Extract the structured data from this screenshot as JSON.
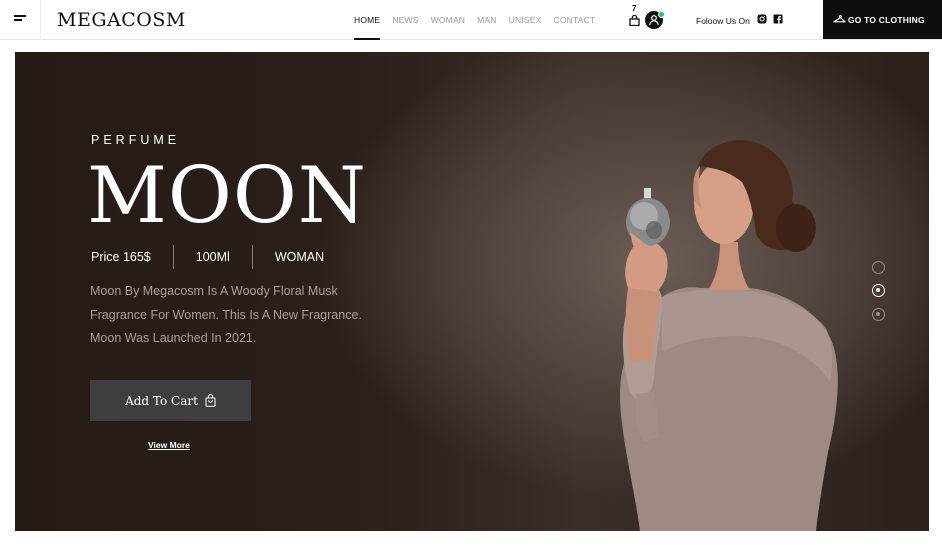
{
  "header": {
    "logo": "MEGACOSM",
    "nav": [
      "HOME",
      "NEWS",
      "WOMAN",
      "MAN",
      "UNISEX",
      "CONTACT"
    ],
    "active_nav": "HOME",
    "cart_count": "7",
    "follow_text": "Foloow Us On",
    "goto_label": "GO TO CLOTHING"
  },
  "hero": {
    "eyebrow": "PERFUME",
    "title": "MOON",
    "price": "Price 165$",
    "volume": "100Ml",
    "gender": "WOMAN",
    "description": "Moon By Megacosm Is A Woody Floral Musk Fragrance For Women. This Is A New Fragrance. Moon Was Launched In 2021.",
    "cta_label": "Add To Cart",
    "view_more": "View More",
    "slides_total": 3,
    "active_slide": 2
  },
  "colors": {
    "accent": "#0e0e0e",
    "hero_bg": "#2b201b",
    "button_bg": "#3e3e3e",
    "online": "#27c46a"
  }
}
